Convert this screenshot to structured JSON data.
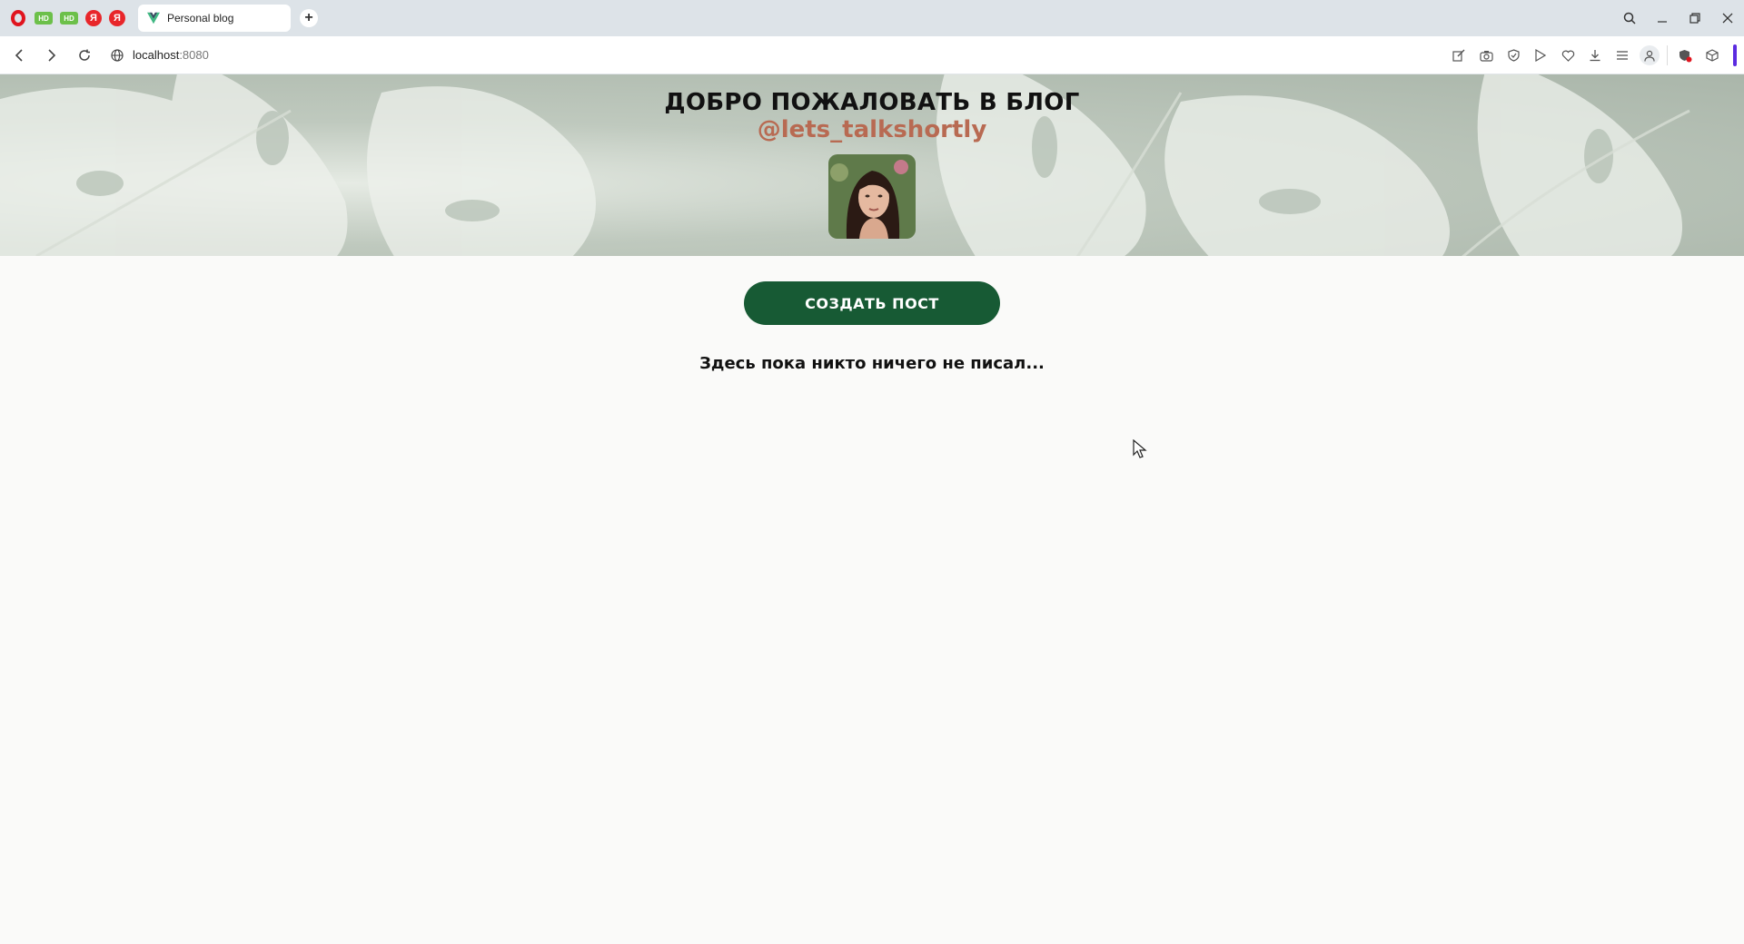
{
  "browser": {
    "pinned_tabs": [
      {
        "icon": "opera-icon"
      },
      {
        "label": "HD",
        "icon": "hd-icon"
      },
      {
        "label": "HD",
        "icon": "hd-icon"
      },
      {
        "label": "Я",
        "icon": "yandex-icon"
      },
      {
        "label": "Я",
        "icon": "yandex-icon"
      }
    ],
    "active_tab": {
      "title": "Personal blog",
      "icon": "vue-icon"
    },
    "new_tab_label": "+",
    "url_host": "localhost",
    "url_port": ":8080",
    "accent_color": "#5b2be0"
  },
  "hero": {
    "title": "ДОБРО ПОЖАЛОВАТЬ В БЛОГ",
    "handle": "@lets_talkshortly",
    "handle_color": "#b86a52",
    "avatar_icon": "avatar-photo"
  },
  "main": {
    "create_button_label": "СОЗДАТЬ ПОСТ",
    "button_color": "#175a34",
    "empty_message": "Здесь пока никто ничего не писал..."
  }
}
